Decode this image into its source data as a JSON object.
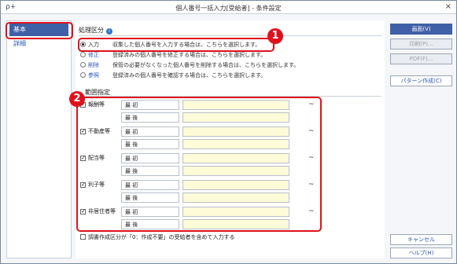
{
  "window": {
    "title": "個人番号一括入力[受給者] - 条件設定",
    "app_icon": "ρ+",
    "close": "×"
  },
  "sidebar": {
    "items": [
      {
        "label": "基本"
      },
      {
        "label": "詳細"
      }
    ]
  },
  "processing": {
    "title": "処理区分",
    "info": "i",
    "options": [
      {
        "label": "入力",
        "desc": "収集した個人番号を入力する場合は、こちらを選択します。",
        "selected": true
      },
      {
        "label": "修正",
        "desc": "登録済みの個人番号を修正する場合は、こちらを選択します。",
        "selected": false
      },
      {
        "label": "削除",
        "desc": "保管の必要がなくなった個人番号を削除する場合は、こちらを選択します。",
        "selected": false
      },
      {
        "label": "参照",
        "desc": "登録済みの個人番号を確認する場合は、こちらを選択します。",
        "selected": false
      }
    ]
  },
  "range": {
    "title": "範囲指定",
    "first_label": "最 初",
    "last_label": "最 後",
    "tilde": "~",
    "categories": [
      {
        "label": "報酬等",
        "checked": true
      },
      {
        "label": "不動産等",
        "checked": true
      },
      {
        "label": "配当等",
        "checked": true
      },
      {
        "label": "利子等",
        "checked": true
      },
      {
        "label": "非居住者等",
        "checked": true
      }
    ]
  },
  "bottom_check": {
    "label": "調書作成区分が「0：作成不要」の受給者を含めて入力する",
    "checked": false
  },
  "buttons": {
    "screen": "画面(V)",
    "print": "印刷(P)...",
    "pdf": "PDF(F)...",
    "pattern": "パターン作成(C)",
    "cancel": "キャンセル",
    "help": "ヘルプ(H)"
  },
  "annotations": {
    "badge1": "1",
    "badge2": "2",
    "color": "#e0101b"
  }
}
